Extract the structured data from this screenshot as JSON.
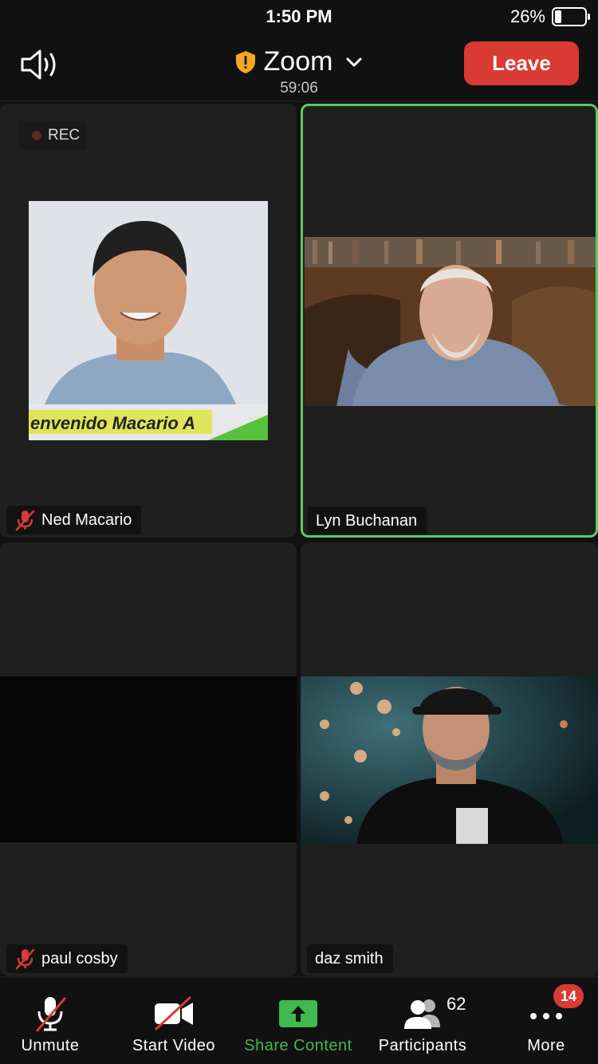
{
  "status_bar": {
    "time": "1:50 PM",
    "battery": "26%"
  },
  "header": {
    "title": "Zoom",
    "timer": "59:06",
    "leave_label": "Leave",
    "speaker_icon": "speaker-icon",
    "shield_icon": "shield-icon"
  },
  "recording": {
    "label": "REC"
  },
  "participants_tiles": [
    {
      "name": "Ned Macario",
      "muted": true,
      "banner_text": "envenido Macario A"
    },
    {
      "name": "Lyn Buchanan",
      "muted": false,
      "active_speaker": true
    },
    {
      "name": "paul cosby",
      "muted": true
    },
    {
      "name": "daz smith",
      "muted": false
    }
  ],
  "toolbar": {
    "unmute_label": "Unmute",
    "start_video_label": "Start Video",
    "share_content_label": "Share Content",
    "participants_label": "Participants",
    "participants_count": "62",
    "more_label": "More",
    "more_badge": "14"
  },
  "colors": {
    "leave_red": "#d93a33",
    "active_green": "#5ccb65",
    "share_green": "#3fb950",
    "shield_yellow": "#f5a623"
  }
}
